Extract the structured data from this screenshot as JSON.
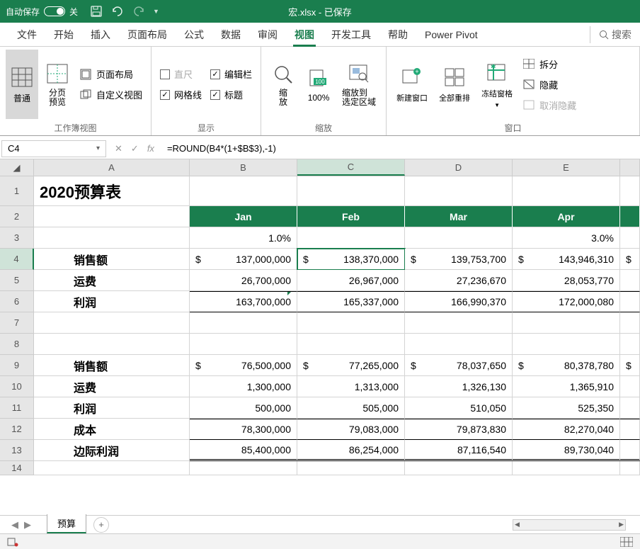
{
  "titlebar": {
    "autosave_label": "自动保存",
    "autosave_state": "关",
    "filename": "宏.xlsx",
    "saved_status": "已保存"
  },
  "ribbon_tabs": {
    "file": "文件",
    "home": "开始",
    "insert": "插入",
    "page_layout": "页面布局",
    "formulas": "公式",
    "data": "数据",
    "review": "审阅",
    "view": "视图",
    "developer": "开发工具",
    "help": "帮助",
    "power_pivot": "Power Pivot",
    "search": "搜索"
  },
  "ribbon": {
    "views": {
      "normal": "普通",
      "page_break": "分页\n预览",
      "page_layout": "页面布局",
      "custom": "自定义视图",
      "group": "工作簿视图"
    },
    "show": {
      "ruler": "直尺",
      "gridlines": "网格线",
      "formula_bar": "编辑栏",
      "headings": "标题",
      "group": "显示"
    },
    "zoom": {
      "zoom": "缩\n放",
      "hundred": "100%",
      "selection": "缩放到\n选定区域",
      "group": "缩放"
    },
    "window": {
      "new": "新建窗口",
      "arrange": "全部重排",
      "freeze": "冻结窗格",
      "split": "拆分",
      "hide": "隐藏",
      "unhide": "取消隐藏",
      "group": "窗口"
    }
  },
  "formula_bar": {
    "cell_ref": "C4",
    "formula": "=ROUND(B4*(1+$B$3),-1)"
  },
  "columns": [
    "A",
    "B",
    "C",
    "D",
    "E"
  ],
  "sheet": {
    "title": "2020预算表",
    "months": [
      "Jan",
      "Feb",
      "Mar",
      "Apr"
    ],
    "rates": [
      "1.0%",
      "",
      "",
      "3.0%"
    ],
    "labels": {
      "sales": "销售额",
      "freight": "运费",
      "profit": "利润",
      "cost": "成本",
      "margin": "边际利润"
    },
    "block1": {
      "sales": [
        "137,000,000",
        "138,370,000",
        "139,753,700",
        "143,946,310"
      ],
      "freight": [
        "26,700,000",
        "26,967,000",
        "27,236,670",
        "28,053,770"
      ],
      "profit": [
        "163,700,000",
        "165,337,000",
        "166,990,370",
        "172,000,080"
      ]
    },
    "block2": {
      "sales": [
        "76,500,000",
        "77,265,000",
        "78,037,650",
        "80,378,780"
      ],
      "freight": [
        "1,300,000",
        "1,313,000",
        "1,326,130",
        "1,365,910"
      ],
      "profit": [
        "500,000",
        "505,000",
        "510,050",
        "525,350"
      ],
      "cost": [
        "78,300,000",
        "79,083,000",
        "79,873,830",
        "82,270,040"
      ],
      "margin": [
        "85,400,000",
        "86,254,000",
        "87,116,540",
        "89,730,040"
      ]
    }
  },
  "sheet_tab": "预算"
}
